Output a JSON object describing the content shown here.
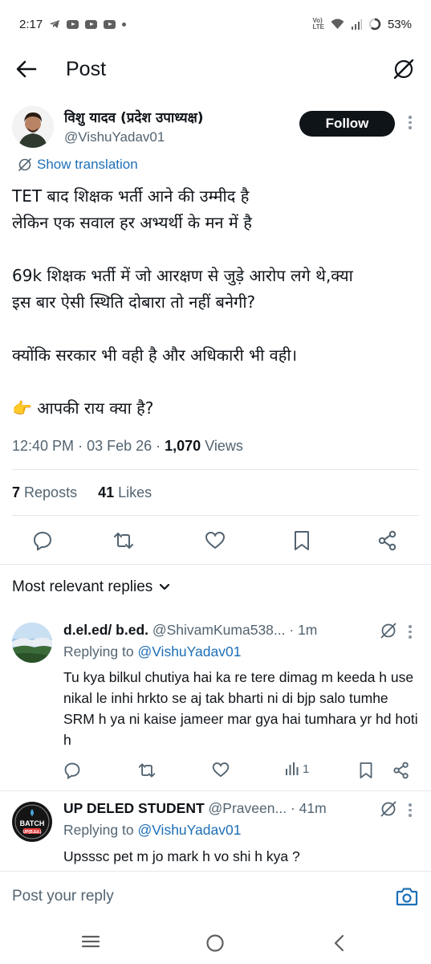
{
  "status_bar": {
    "time": "2:17",
    "battery": "53%",
    "network": "VoLTE"
  },
  "header": {
    "title": "Post"
  },
  "post": {
    "author_name": "विशु यादव (प्रदेश उपाध्यक्ष)",
    "author_handle": "@VishuYadav01",
    "follow_label": "Follow",
    "show_translation": "Show translation",
    "lines": [
      "TET बाद शिक्षक भर्ती आने की उम्मीद है",
      "लेकिन एक सवाल हर अभ्यर्थी के मन में है",
      "69k शिक्षक भर्ती में जो आरक्षण से जुड़े आरोप लगे थे,क्या",
      "इस बार ऐसी स्थिति दोबारा तो नहीं बनेगी?",
      "क्योंकि सरकार भी वही है और अधिकारी भी वही।",
      "👉 आपकी राय क्या है?"
    ],
    "time": "12:40 PM",
    "date": "03 Feb 26",
    "views_count": "1,070",
    "views_label": "Views",
    "reposts_count": "7",
    "reposts_label": "Reposts",
    "likes_count": "41",
    "likes_label": "Likes"
  },
  "replies_section": {
    "header": "Most relevant replies"
  },
  "replies": [
    {
      "name": "d.el.ed/ b.ed.",
      "handle": "@ShivamKuma538...",
      "time": "1m",
      "replying_prefix": "Replying to",
      "replying_to": "@VishuYadav01",
      "text": "Tu kya bilkul chutiya hai ka re tere dimag m keeda h use nikal le inhi hrkto se aj tak bharti ni di bjp salo tumhe SRM h ya ni kaise jameer mar gya hai tumhara yr hd hoti h",
      "views": "1"
    },
    {
      "name": "UP DELED STUDENT",
      "handle": "@Praveen...",
      "time": "41m",
      "replying_prefix": "Replying to",
      "replying_to": "@VishuYadav01",
      "text": "Upsssc pet m jo mark h vo shi h kya ?",
      "avatar_text_top": "BATCH",
      "avatar_text_bottom": "UP(B.Ed.)"
    }
  ],
  "reply_bar": {
    "placeholder": "Post your reply"
  },
  "icons": {
    "back": "arrow-left-icon",
    "grok": "grok-icon",
    "reply": "reply-icon",
    "repost": "repost-icon",
    "like": "heart-icon",
    "bookmark": "bookmark-icon",
    "share": "share-icon",
    "views": "views-icon",
    "camera": "camera-icon"
  },
  "colors": {
    "text": "#0f1419",
    "secondary": "#536471",
    "link": "#1d6fb8",
    "follow_bg": "#0f1419"
  }
}
